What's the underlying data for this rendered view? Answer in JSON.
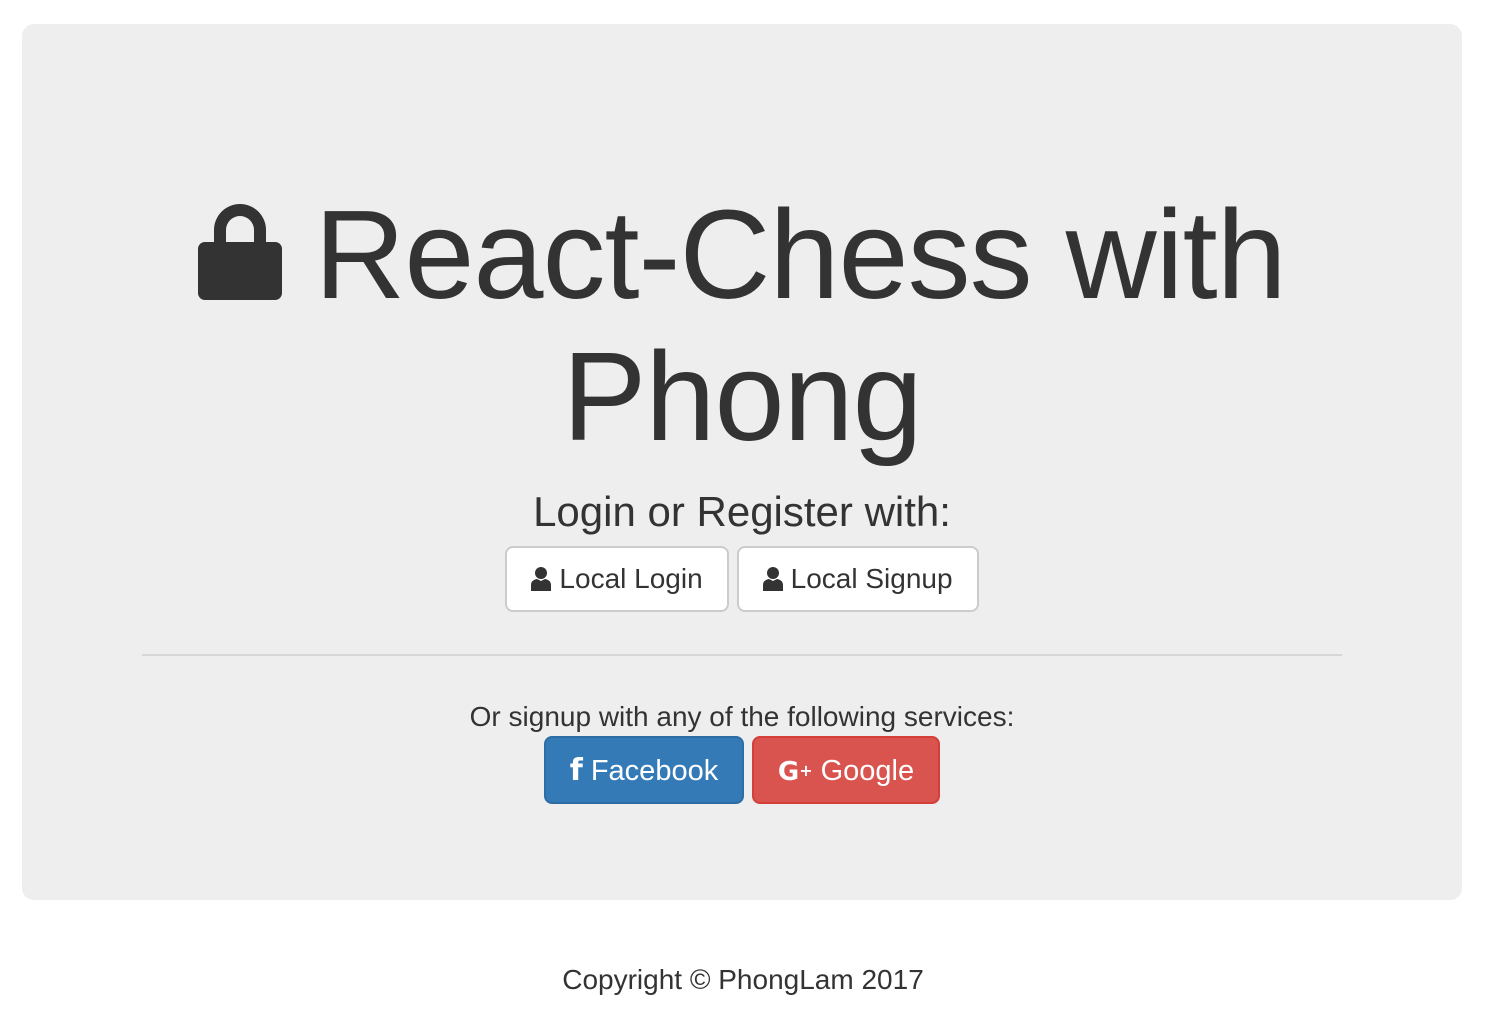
{
  "header": {
    "icon": "lock-icon",
    "title": "React-Chess with Phong"
  },
  "auth": {
    "prompt": "Login or Register with:",
    "local_login_label": "Local Login",
    "local_signup_label": "Local Signup",
    "local_icon": "user-icon"
  },
  "services": {
    "prompt": "Or signup with any of the following services:",
    "facebook_label": "Facebook",
    "facebook_icon": "facebook-icon",
    "facebook_color": "#337ab7",
    "google_label": "Google",
    "google_icon": "google-plus-icon",
    "google_color": "#d9534f"
  },
  "footer": {
    "copyright": "Copyright © PhongLam 2017"
  },
  "colors": {
    "jumbotron_bg": "#eeeeee",
    "text": "#333333"
  }
}
